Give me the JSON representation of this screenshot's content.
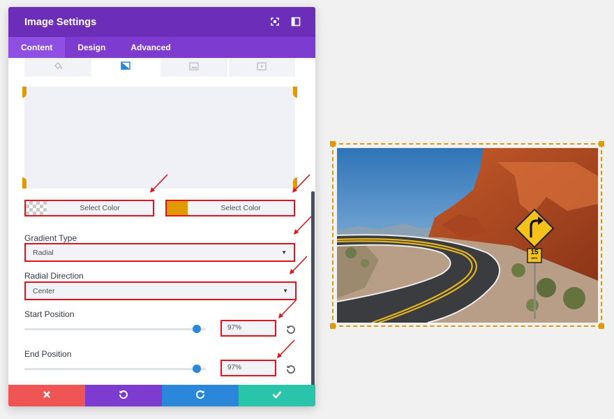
{
  "panel": {
    "title": "Image Settings",
    "tabs": [
      {
        "label": "Content",
        "active": true
      },
      {
        "label": "Design",
        "active": false
      },
      {
        "label": "Advanced",
        "active": false
      }
    ],
    "subtabs": [
      {
        "icon": "paint-bucket-icon"
      },
      {
        "icon": "gradient-icon",
        "active": true
      },
      {
        "icon": "image-icon"
      },
      {
        "icon": "video-icon"
      }
    ]
  },
  "gradient": {
    "color1": {
      "label": "Select Color",
      "swatch": "transparent"
    },
    "color2": {
      "label": "Select Color",
      "swatch": "#e09900"
    },
    "type_label": "Gradient Type",
    "type_value": "Radial",
    "direction_label": "Radial Direction",
    "direction_value": "Center",
    "start_label": "Start Position",
    "start_value": "97%",
    "end_label": "End Position",
    "end_value": "97%"
  },
  "footer": {
    "buttons": [
      {
        "icon": "close-icon",
        "color": "#ef5555"
      },
      {
        "icon": "undo-icon",
        "color": "#7d3bcf"
      },
      {
        "icon": "redo-icon",
        "color": "#2b87da"
      },
      {
        "icon": "check-icon",
        "color": "#29c4a9"
      }
    ]
  },
  "colors": {
    "header": "#6c2eb9",
    "tabs": "#7d3bcf",
    "accent_orange": "#e09900",
    "highlight_red": "#e0141e",
    "slider": "#2b87da"
  },
  "image": {
    "description_icon": "road-photo",
    "sign_text": "15",
    "sign_sub": "MPH"
  }
}
